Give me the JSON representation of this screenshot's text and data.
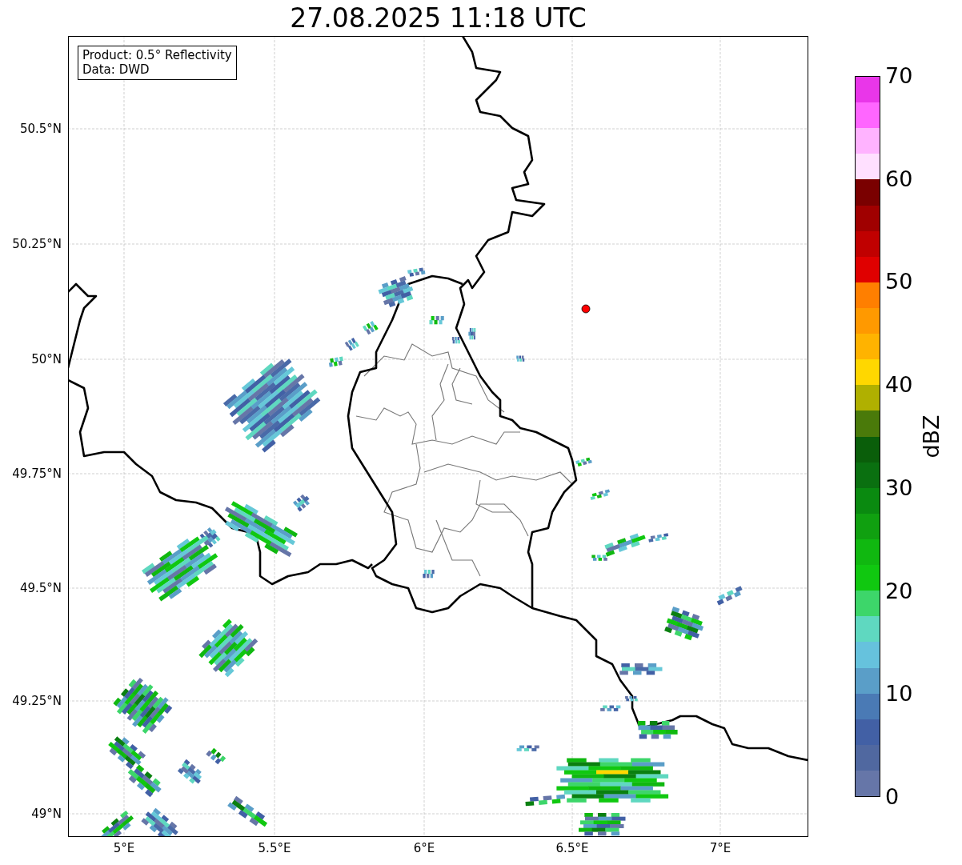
{
  "title": "27.08.2025 11:18 UTC",
  "info_box": [
    "Product: 0.5° Reflectivity",
    "Data: DWD"
  ],
  "map": {
    "lat_ticks": [
      "50.5°N",
      "50.25°N",
      "50°N",
      "49.75°N",
      "49.5°N",
      "49.25°N",
      "49°N"
    ],
    "lon_ticks": [
      "5°E",
      "5.5°E",
      "6°E",
      "6.5°E",
      "7°E"
    ]
  },
  "colorbar": {
    "label": "dBZ",
    "ticks": [
      "70",
      "60",
      "50",
      "40",
      "30",
      "20",
      "10",
      "0"
    ],
    "steps": [
      {
        "color": "#e936e9"
      },
      {
        "color": "#ff66ff"
      },
      {
        "color": "#ffb3ff"
      },
      {
        "color": "#ffe0ff"
      },
      {
        "color": "#7a0000"
      },
      {
        "color": "#a00000"
      },
      {
        "color": "#c00000"
      },
      {
        "color": "#e00000"
      },
      {
        "color": "#ff7f00"
      },
      {
        "color": "#ff9900"
      },
      {
        "color": "#ffb300"
      },
      {
        "color": "#ffd700"
      },
      {
        "color": "#b0b000"
      },
      {
        "color": "#4a7a0a"
      },
      {
        "color": "#0a5e0a"
      },
      {
        "color": "#0a7010"
      },
      {
        "color": "#0a8a10"
      },
      {
        "color": "#10a010"
      },
      {
        "color": "#10b810"
      },
      {
        "color": "#10c810"
      },
      {
        "color": "#3dd66a"
      },
      {
        "color": "#5fd8c0"
      },
      {
        "color": "#66c2dd"
      },
      {
        "color": "#5a9ec8"
      },
      {
        "color": "#4a7ab5"
      },
      {
        "color": "#4260a5"
      },
      {
        "color": "#5068a0"
      },
      {
        "color": "#6676a8"
      }
    ]
  }
}
